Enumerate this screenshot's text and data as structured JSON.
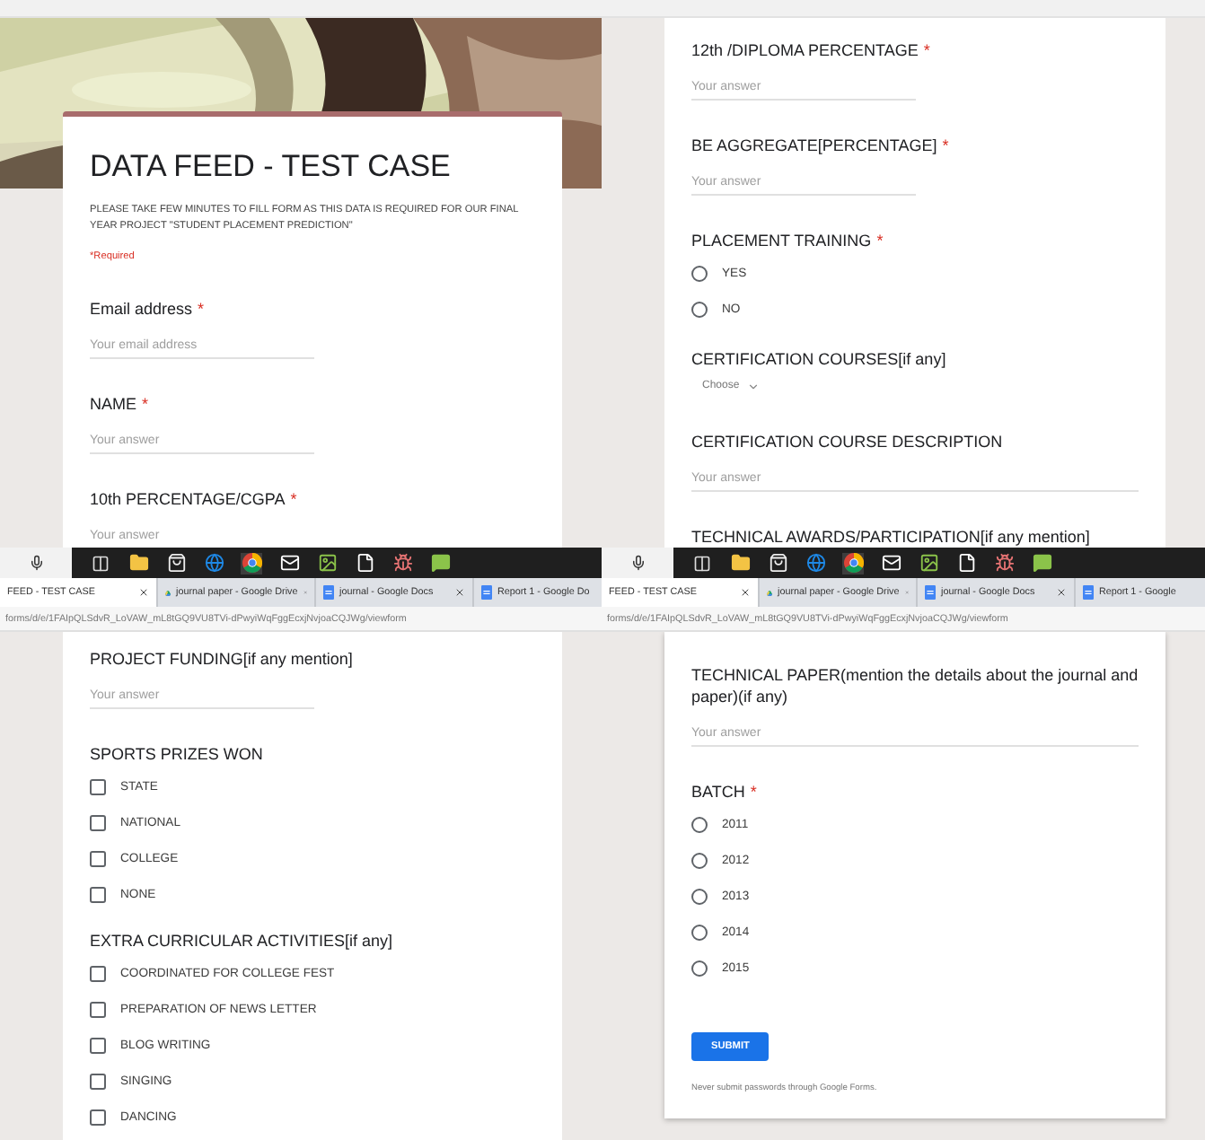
{
  "panels": [
    {
      "banner": {
        "kind": "picture"
      },
      "form_header": {
        "title": "DATA FEED - TEST CASE",
        "description": "PLEASE TAKE FEW MINUTES TO FILL FORM AS THIS DATA IS REQUIRED FOR OUR FINAL YEAR PROJECT \"STUDENT PLACEMENT PREDICTION\"",
        "required_note": "*Required"
      },
      "items": [
        {
          "kind": "short_answer",
          "label": "Email address",
          "required_mark": "*",
          "placeholder": "Your email address"
        },
        {
          "kind": "short_answer",
          "label": "NAME",
          "required_mark": "*",
          "placeholder": "Your answer"
        },
        {
          "kind": "short_answer",
          "label": "10th PERCENTAGE/CGPA",
          "required_mark": "*",
          "placeholder": "Your answer"
        }
      ]
    },
    {
      "items": [
        {
          "kind": "short_answer",
          "label": "12th /DIPLOMA PERCENTAGE",
          "required_mark": "*",
          "placeholder": "Your answer"
        },
        {
          "kind": "short_answer",
          "label": "BE AGGREGATE[PERCENTAGE]",
          "required_mark": "*",
          "placeholder": "Your answer"
        },
        {
          "kind": "radio",
          "label": "PLACEMENT TRAINING",
          "required_mark": "*",
          "options": [
            {
              "label": "YES",
              "selected": false
            },
            {
              "label": "NO",
              "selected": false
            }
          ]
        },
        {
          "kind": "dropdown",
          "label": "CERTIFICATION COURSES[if any]",
          "placeholder": "Choose"
        },
        {
          "kind": "paragraph",
          "label": "CERTIFICATION COURSE DESCRIPTION",
          "placeholder": "Your answer"
        },
        {
          "kind": "paragraph",
          "label": "TECHNICAL AWARDS/PARTICIPATION[if any mention]"
        }
      ]
    },
    {
      "items": [
        {
          "kind": "short_answer",
          "label": "PROJECT FUNDING[if any mention]",
          "placeholder": "Your answer"
        },
        {
          "kind": "checkbox",
          "label": "SPORTS PRIZES WON",
          "options": [
            {
              "label": "STATE",
              "checked": false
            },
            {
              "label": "NATIONAL",
              "checked": false
            },
            {
              "label": "COLLEGE",
              "checked": false
            },
            {
              "label": "NONE",
              "checked": false
            }
          ]
        },
        {
          "kind": "checkbox",
          "label": "EXTRA CURRICULAR ACTIVITIES[if any]",
          "options": [
            {
              "label": "COORDINATED FOR COLLEGE FEST",
              "checked": false
            },
            {
              "label": "PREPARATION OF NEWS LETTER",
              "checked": false
            },
            {
              "label": "BLOG WRITING",
              "checked": false
            },
            {
              "label": "SINGING",
              "checked": false
            },
            {
              "label": "DANCING",
              "checked": false
            }
          ]
        }
      ]
    },
    {
      "items": [
        {
          "kind": "paragraph",
          "label": "TECHNICAL PAPER(mention the details about the journal and paper)(if any)",
          "placeholder": "Your answer"
        },
        {
          "kind": "radio",
          "label": "BATCH",
          "required_mark": "*",
          "options": [
            {
              "label": "2011",
              "selected": false
            },
            {
              "label": "2012",
              "selected": false
            },
            {
              "label": "2013",
              "selected": false
            },
            {
              "label": "2014",
              "selected": false
            },
            {
              "label": "2015",
              "selected": false
            }
          ]
        }
      ],
      "submit": {
        "label": "SUBMIT"
      },
      "footer_note": "Never submit passwords through Google Forms."
    }
  ],
  "browser_strips": [
    {
      "tabs": [
        {
          "title": "FEED - TEST CASE",
          "kind": "form",
          "selected": true,
          "closable": true
        },
        {
          "title": "journal paper - Google Drive",
          "kind": "drive",
          "selected": false,
          "closable": true
        },
        {
          "title": "journal - Google Docs",
          "kind": "docs",
          "selected": false,
          "closable": true
        },
        {
          "title": "Report 1 - Google Do",
          "kind": "docs",
          "selected": false,
          "closable": false
        }
      ],
      "url": "forms/d/e/1FAIpQLSdvR_LoVAW_mL8tGQ9VU8TVi-dPwyiWqFggEcxjNvjoaCQJWg/viewform"
    },
    {
      "tabs": [
        {
          "title": "FEED - TEST CASE",
          "kind": "form",
          "selected": true,
          "closable": true
        },
        {
          "title": "journal paper - Google Drive",
          "kind": "drive",
          "selected": false,
          "closable": true
        },
        {
          "title": "journal - Google Docs",
          "kind": "docs",
          "selected": false,
          "closable": true
        },
        {
          "title": "Report 1 - Google",
          "kind": "docs",
          "selected": false,
          "closable": false
        }
      ],
      "url": "forms/d/e/1FAIpQLSdvR_LoVAW_mL8tGQ9VU8TVi-dPwyiWqFggEcxjNvjoaCQJWg/viewform"
    }
  ]
}
